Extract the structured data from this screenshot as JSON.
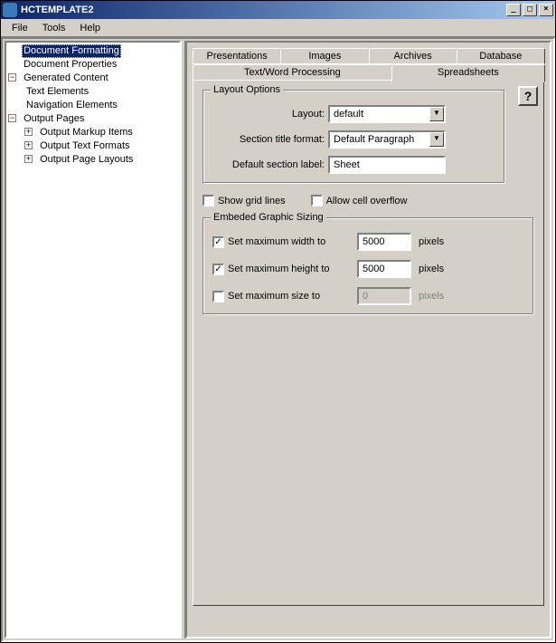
{
  "window": {
    "title": "HCTEMPLATE2",
    "min": "_",
    "max": "□",
    "close": "×"
  },
  "menu": {
    "file": "File",
    "tools": "Tools",
    "help": "Help"
  },
  "tree": {
    "doc_formatting": "Document Formatting",
    "doc_properties": "Document Properties",
    "generated_content": "Generated Content",
    "text_elements": "Text Elements",
    "nav_elements": "Navigation Elements",
    "output_pages": "Output Pages",
    "output_markup": "Output Markup Items",
    "output_text_formats": "Output Text Formats",
    "output_page_layouts": "Output Page Layouts"
  },
  "tabs": {
    "presentations": "Presentations",
    "images": "Images",
    "archives": "Archives",
    "database": "Database",
    "text_wp": "Text/Word Processing",
    "spreadsheets": "Spreadsheets"
  },
  "layout_options": {
    "legend": "Layout Options",
    "layout_label": "Layout:",
    "layout_value": "default",
    "section_title_label": "Section title format:",
    "section_title_value": "Default Paragraph",
    "default_section_label": "Default section label:",
    "default_section_value": "Sheet"
  },
  "flags": {
    "show_grid": "Show grid lines",
    "allow_overflow": "Allow cell overflow"
  },
  "graphic_sizing": {
    "legend": "Embeded Graphic Sizing",
    "max_width_label": "Set maximum width to",
    "max_width_value": "5000",
    "max_height_label": "Set maximum height to",
    "max_height_value": "5000",
    "max_size_label": "Set maximum size to",
    "max_size_value": "0",
    "unit": "pixels"
  },
  "help_btn": "?"
}
